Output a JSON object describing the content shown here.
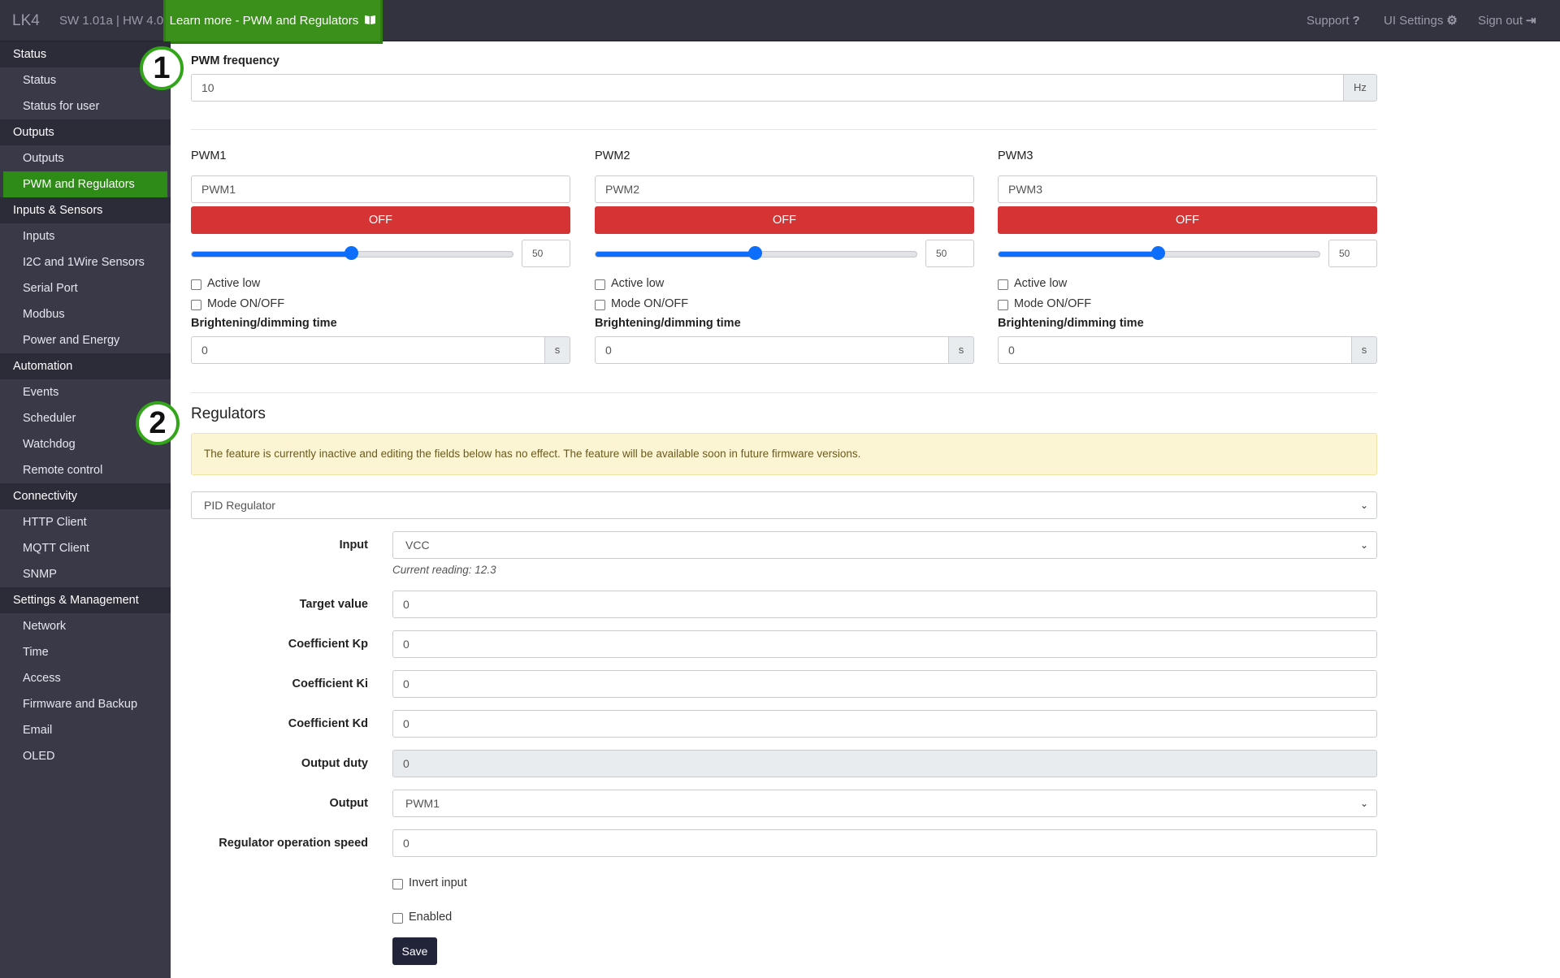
{
  "topbar": {
    "brand": "LK4",
    "version": "SW 1.01a | HW 4.0",
    "learn_more": "Learn more - PWM and Regulators",
    "learn_more_icon": "book-icon",
    "support": "Support",
    "support_icon": "?",
    "ui_settings": "UI Settings",
    "ui_settings_icon": "⚙",
    "sign_out": "Sign out",
    "sign_out_icon": "⇥"
  },
  "sidebar": {
    "status_section": "Status",
    "status": "Status",
    "status_for_user": "Status for user",
    "outputs_section": "Outputs",
    "outputs": "Outputs",
    "pwm_and_regulators": "PWM and Regulators",
    "inputs_sensors_section": "Inputs & Sensors",
    "inputs": "Inputs",
    "i2c_1wire": "I2C and 1Wire Sensors",
    "serial_port": "Serial Port",
    "modbus": "Modbus",
    "power_energy": "Power and Energy",
    "automation_section": "Automation",
    "events": "Events",
    "scheduler": "Scheduler",
    "watchdog": "Watchdog",
    "remote_control": "Remote control",
    "connectivity_section": "Connectivity",
    "http_client": "HTTP Client",
    "mqtt_client": "MQTT Client",
    "snmp": "SNMP",
    "settings_section": "Settings & Management",
    "network": "Network",
    "time": "Time",
    "access": "Access",
    "firmware_backup": "Firmware and Backup",
    "email": "Email",
    "oled": "OLED"
  },
  "annotations": {
    "one": "1",
    "two": "2",
    "color": "#33a51a"
  },
  "pwm_frequency": {
    "label": "PWM frequency",
    "value": "10",
    "unit": "Hz"
  },
  "pwm": [
    {
      "label": "PWM1",
      "name": "PWM1",
      "button": "OFF",
      "level": 50,
      "level_text": "50",
      "active_low": "Active low",
      "mode_onoff": "Mode ON/OFF",
      "dim_label": "Brightening/dimming time",
      "dim_value": "0",
      "dim_unit": "s"
    },
    {
      "label": "PWM2",
      "name": "PWM2",
      "button": "OFF",
      "level": 50,
      "level_text": "50",
      "active_low": "Active low",
      "mode_onoff": "Mode ON/OFF",
      "dim_label": "Brightening/dimming time",
      "dim_value": "0",
      "dim_unit": "s"
    },
    {
      "label": "PWM3",
      "name": "PWM3",
      "button": "OFF",
      "level": 50,
      "level_text": "50",
      "active_low": "Active low",
      "mode_onoff": "Mode ON/OFF",
      "dim_label": "Brightening/dimming time",
      "dim_value": "0",
      "dim_unit": "s"
    }
  ],
  "regulators": {
    "title": "Regulators",
    "alert": "The feature is currently inactive and editing the fields below has no effect. The feature will be available soon in future firmware versions.",
    "type_select": "PID Regulator",
    "input_label": "Input",
    "input_value": "VCC",
    "current_reading": "Current reading: 12.3",
    "target_label": "Target value",
    "target_value": "0",
    "kp_label": "Coefficient Kp",
    "kp_value": "0",
    "ki_label": "Coefficient Ki",
    "ki_value": "0",
    "kd_label": "Coefficient Kd",
    "kd_value": "0",
    "duty_label": "Output duty",
    "duty_value": "0",
    "output_label": "Output",
    "output_value": "PWM1",
    "speed_label": "Regulator operation speed",
    "speed_value": "0",
    "invert_input": "Invert input",
    "enabled": "Enabled",
    "save": "Save"
  },
  "colors": {
    "accent_green": "#2f8b18",
    "off_red": "#d63434",
    "slider_blue": "#0d6efd",
    "sidebar_bg": "#3a3947"
  }
}
